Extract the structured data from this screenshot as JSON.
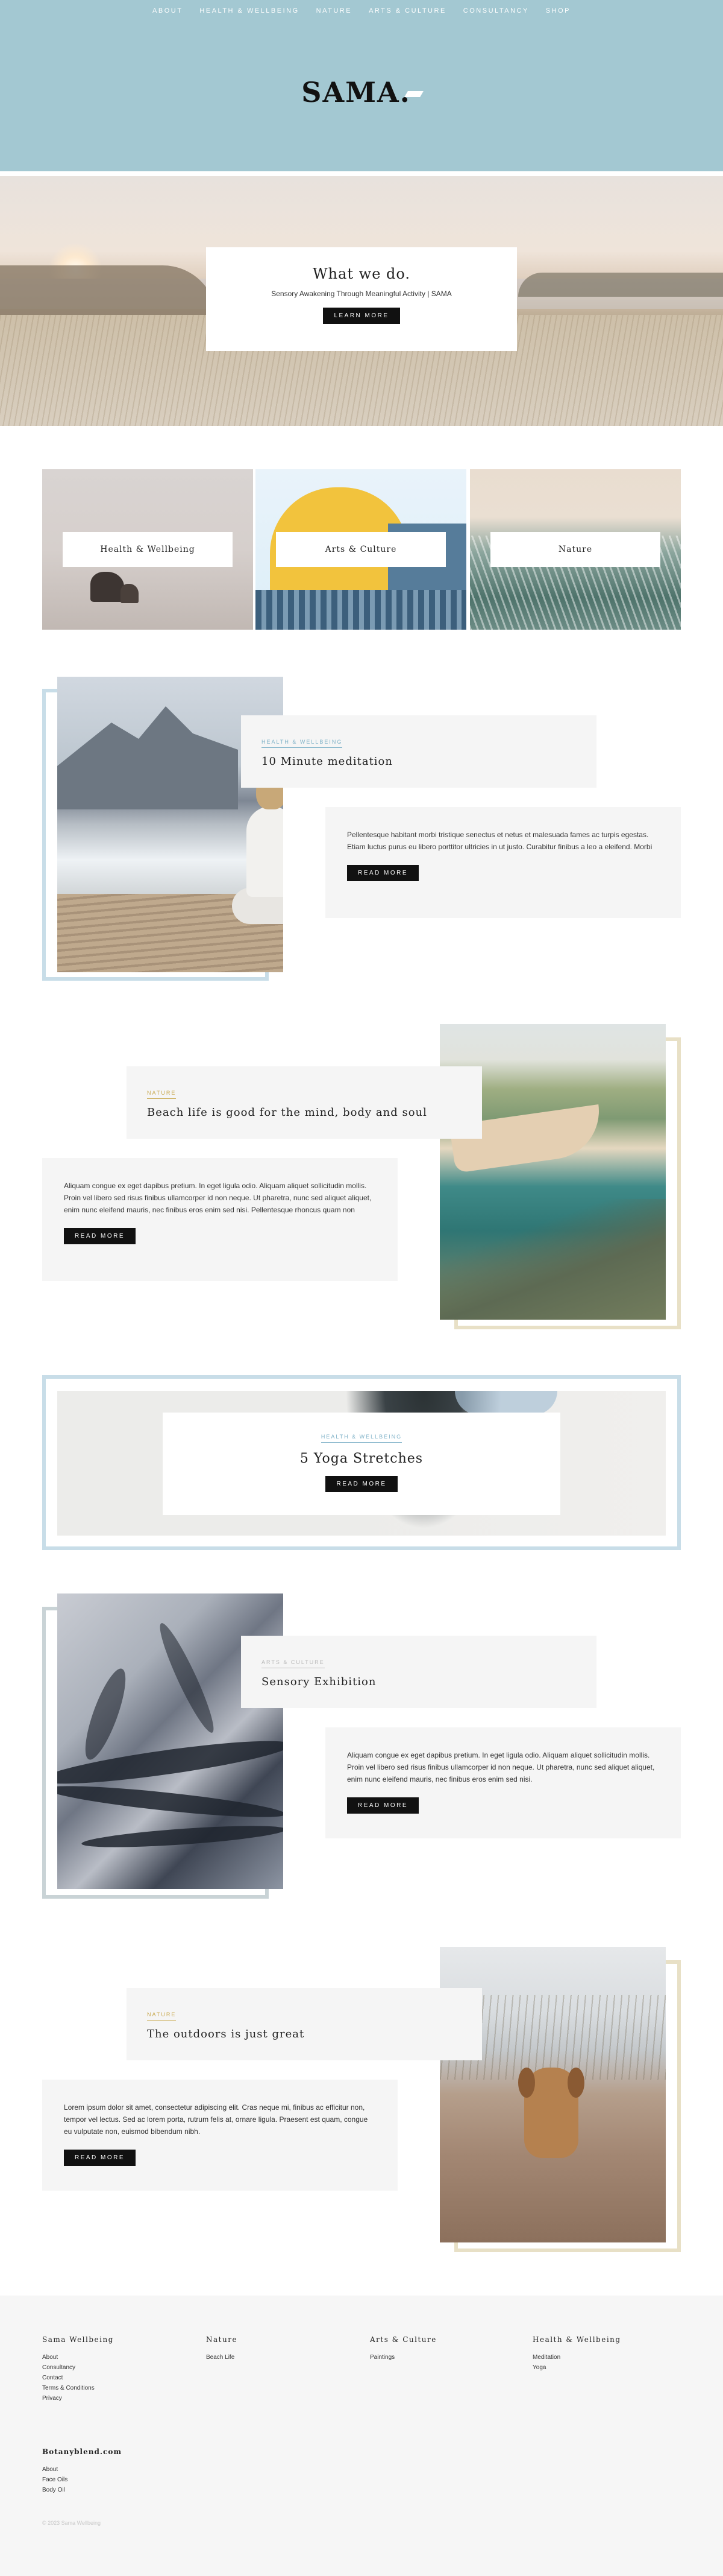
{
  "nav": [
    "About",
    "Health & Wellbeing",
    "Nature",
    "Arts & Culture",
    "Consultancy",
    "Shop"
  ],
  "logo": "SAMA.",
  "hero": {
    "title": "What we do.",
    "subtitle": "Sensory Awakening Through Meaningful Activity | SAMA",
    "button": "Learn More"
  },
  "categories": [
    "Health & Wellbeing",
    "Arts & Culture",
    "Nature"
  ],
  "articles": [
    {
      "tag": "Health & Wellbeing",
      "title": "10 Minute meditation",
      "body": "Pellentesque habitant morbi tristique senectus et netus et malesuada fames ac turpis egestas. Etiam luctus purus eu libero porttitor ultricies in ut justo. Curabitur finibus a leo a eleifend. Morbi",
      "button": "Read More"
    },
    {
      "tag": "Nature",
      "title": "Beach life is good for the mind, body and soul",
      "body": "Aliquam congue ex eget dapibus pretium. In eget ligula odio. Aliquam aliquet sollicitudin mollis. Proin vel libero sed risus finibus ullamcorper id non neque. Ut pharetra, nunc sed aliquet aliquet, enim nunc eleifend mauris, nec finibus eros enim sed nisi. Pellentesque rhoncus quam non",
      "button": "Read More"
    },
    {
      "tag": "Health & Wellbeing",
      "title": "5 Yoga Stretches",
      "button": "Read More"
    },
    {
      "tag": "Arts & Culture",
      "title": "Sensory Exhibition",
      "body": "Aliquam congue ex eget dapibus pretium. In eget ligula odio. Aliquam aliquet sollicitudin mollis. Proin vel libero sed risus finibus ullamcorper id non neque. Ut pharetra, nunc sed aliquet aliquet, enim nunc eleifend mauris, nec finibus eros enim sed nisi.",
      "button": "Read More"
    },
    {
      "tag": "Nature",
      "title": "The outdoors is just great",
      "body": "Lorem ipsum dolor sit amet, consectetur adipiscing elit. Cras neque mi, finibus ac efficitur non, tempor vel lectus. Sed ac lorem porta, rutrum felis at, ornare ligula. Praesent est quam, congue eu vulputate non, euismod bibendum nibh.",
      "button": "Read More"
    }
  ],
  "footer": {
    "columns": [
      {
        "title": "Sama Wellbeing",
        "links": [
          "About",
          "Consultancy",
          "Contact",
          "Terms & Conditions",
          "Privacy"
        ]
      },
      {
        "title": "Nature",
        "links": [
          "Beach Life"
        ]
      },
      {
        "title": "Arts & Culture",
        "links": [
          "Paintings"
        ]
      },
      {
        "title": "Health & Wellbeing",
        "links": [
          "Meditation",
          "Yoga"
        ]
      }
    ],
    "brand": {
      "title": "Botanyblend.com",
      "links": [
        "About",
        "Face Oils",
        "Body Oil"
      ]
    },
    "copyright": "© 2023 Sama Wellbeing"
  },
  "colors": {
    "header_bg": "#a3c8d2",
    "frame_blue": "#c8dde8",
    "frame_gold": "#e8e0c6",
    "frame_grey": "#c9d3d6",
    "button": "#111111",
    "panel": "#f5f5f5"
  }
}
